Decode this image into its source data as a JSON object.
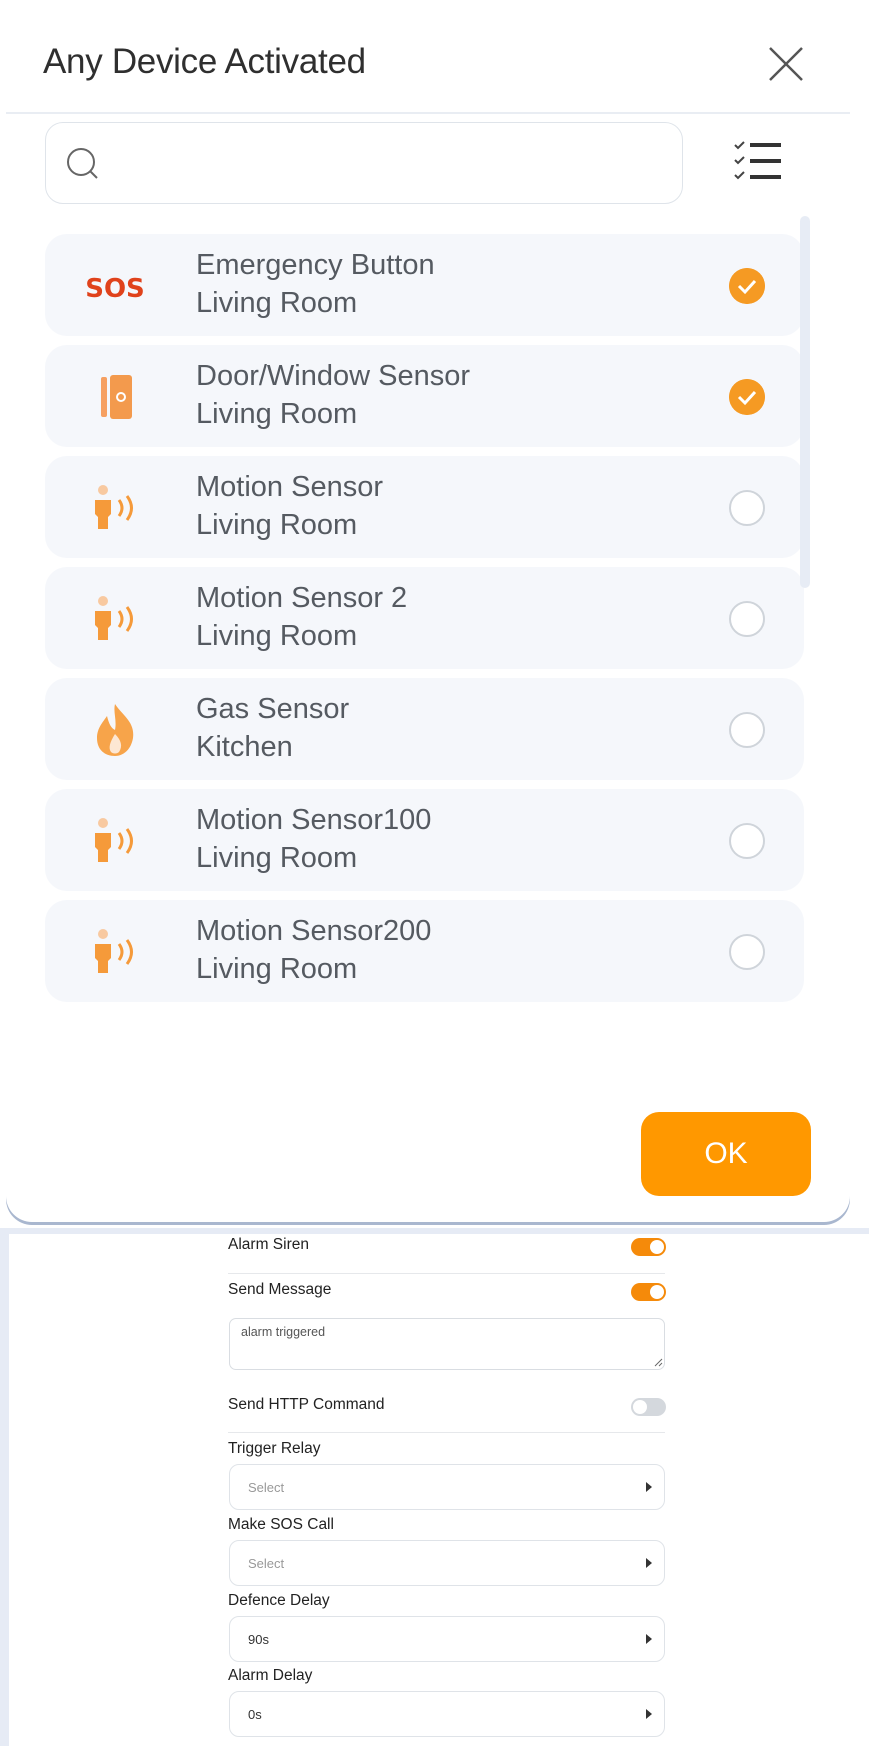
{
  "dialog": {
    "title": "Any Device Activated",
    "search": {
      "value": "",
      "placeholder": ""
    },
    "items": [
      {
        "name": "Emergency Button",
        "room": "Living Room",
        "icon": "sos-icon",
        "checked": true
      },
      {
        "name": "Door/Window Sensor",
        "room": "Living Room",
        "icon": "door-sensor-icon",
        "checked": true
      },
      {
        "name": "Motion Sensor",
        "room": "Living Room",
        "icon": "motion-sensor-icon",
        "checked": false
      },
      {
        "name": "Motion Sensor 2",
        "room": "Living Room",
        "icon": "motion-sensor-icon",
        "checked": false
      },
      {
        "name": "Gas Sensor",
        "room": "Kitchen",
        "icon": "flame-icon",
        "checked": false
      },
      {
        "name": "Motion Sensor100",
        "room": "Living Room",
        "icon": "motion-sensor-icon",
        "checked": false
      },
      {
        "name": "Motion Sensor200",
        "room": "Living Room",
        "icon": "motion-sensor-icon",
        "checked": false
      }
    ],
    "ok_label": "OK",
    "sos_text": "SOS"
  },
  "settings": {
    "alarm_siren": {
      "label": "Alarm Siren",
      "on": true
    },
    "send_message": {
      "label": "Send Message",
      "on": true,
      "message": "alarm triggered"
    },
    "send_http": {
      "label": "Send HTTP Command",
      "on": false
    },
    "trigger_relay": {
      "label": "Trigger Relay",
      "value": "Select"
    },
    "sos_call": {
      "label": "Make SOS Call",
      "value": "Select"
    },
    "defence_delay": {
      "label": "Defence Delay",
      "value": "90s"
    },
    "alarm_delay": {
      "label": "Alarm Delay",
      "value": "0s"
    }
  },
  "colors": {
    "accent": "#ff9800",
    "check": "#f59a23",
    "sos": "#e0421b",
    "toggle_on": "#f58a0a"
  }
}
